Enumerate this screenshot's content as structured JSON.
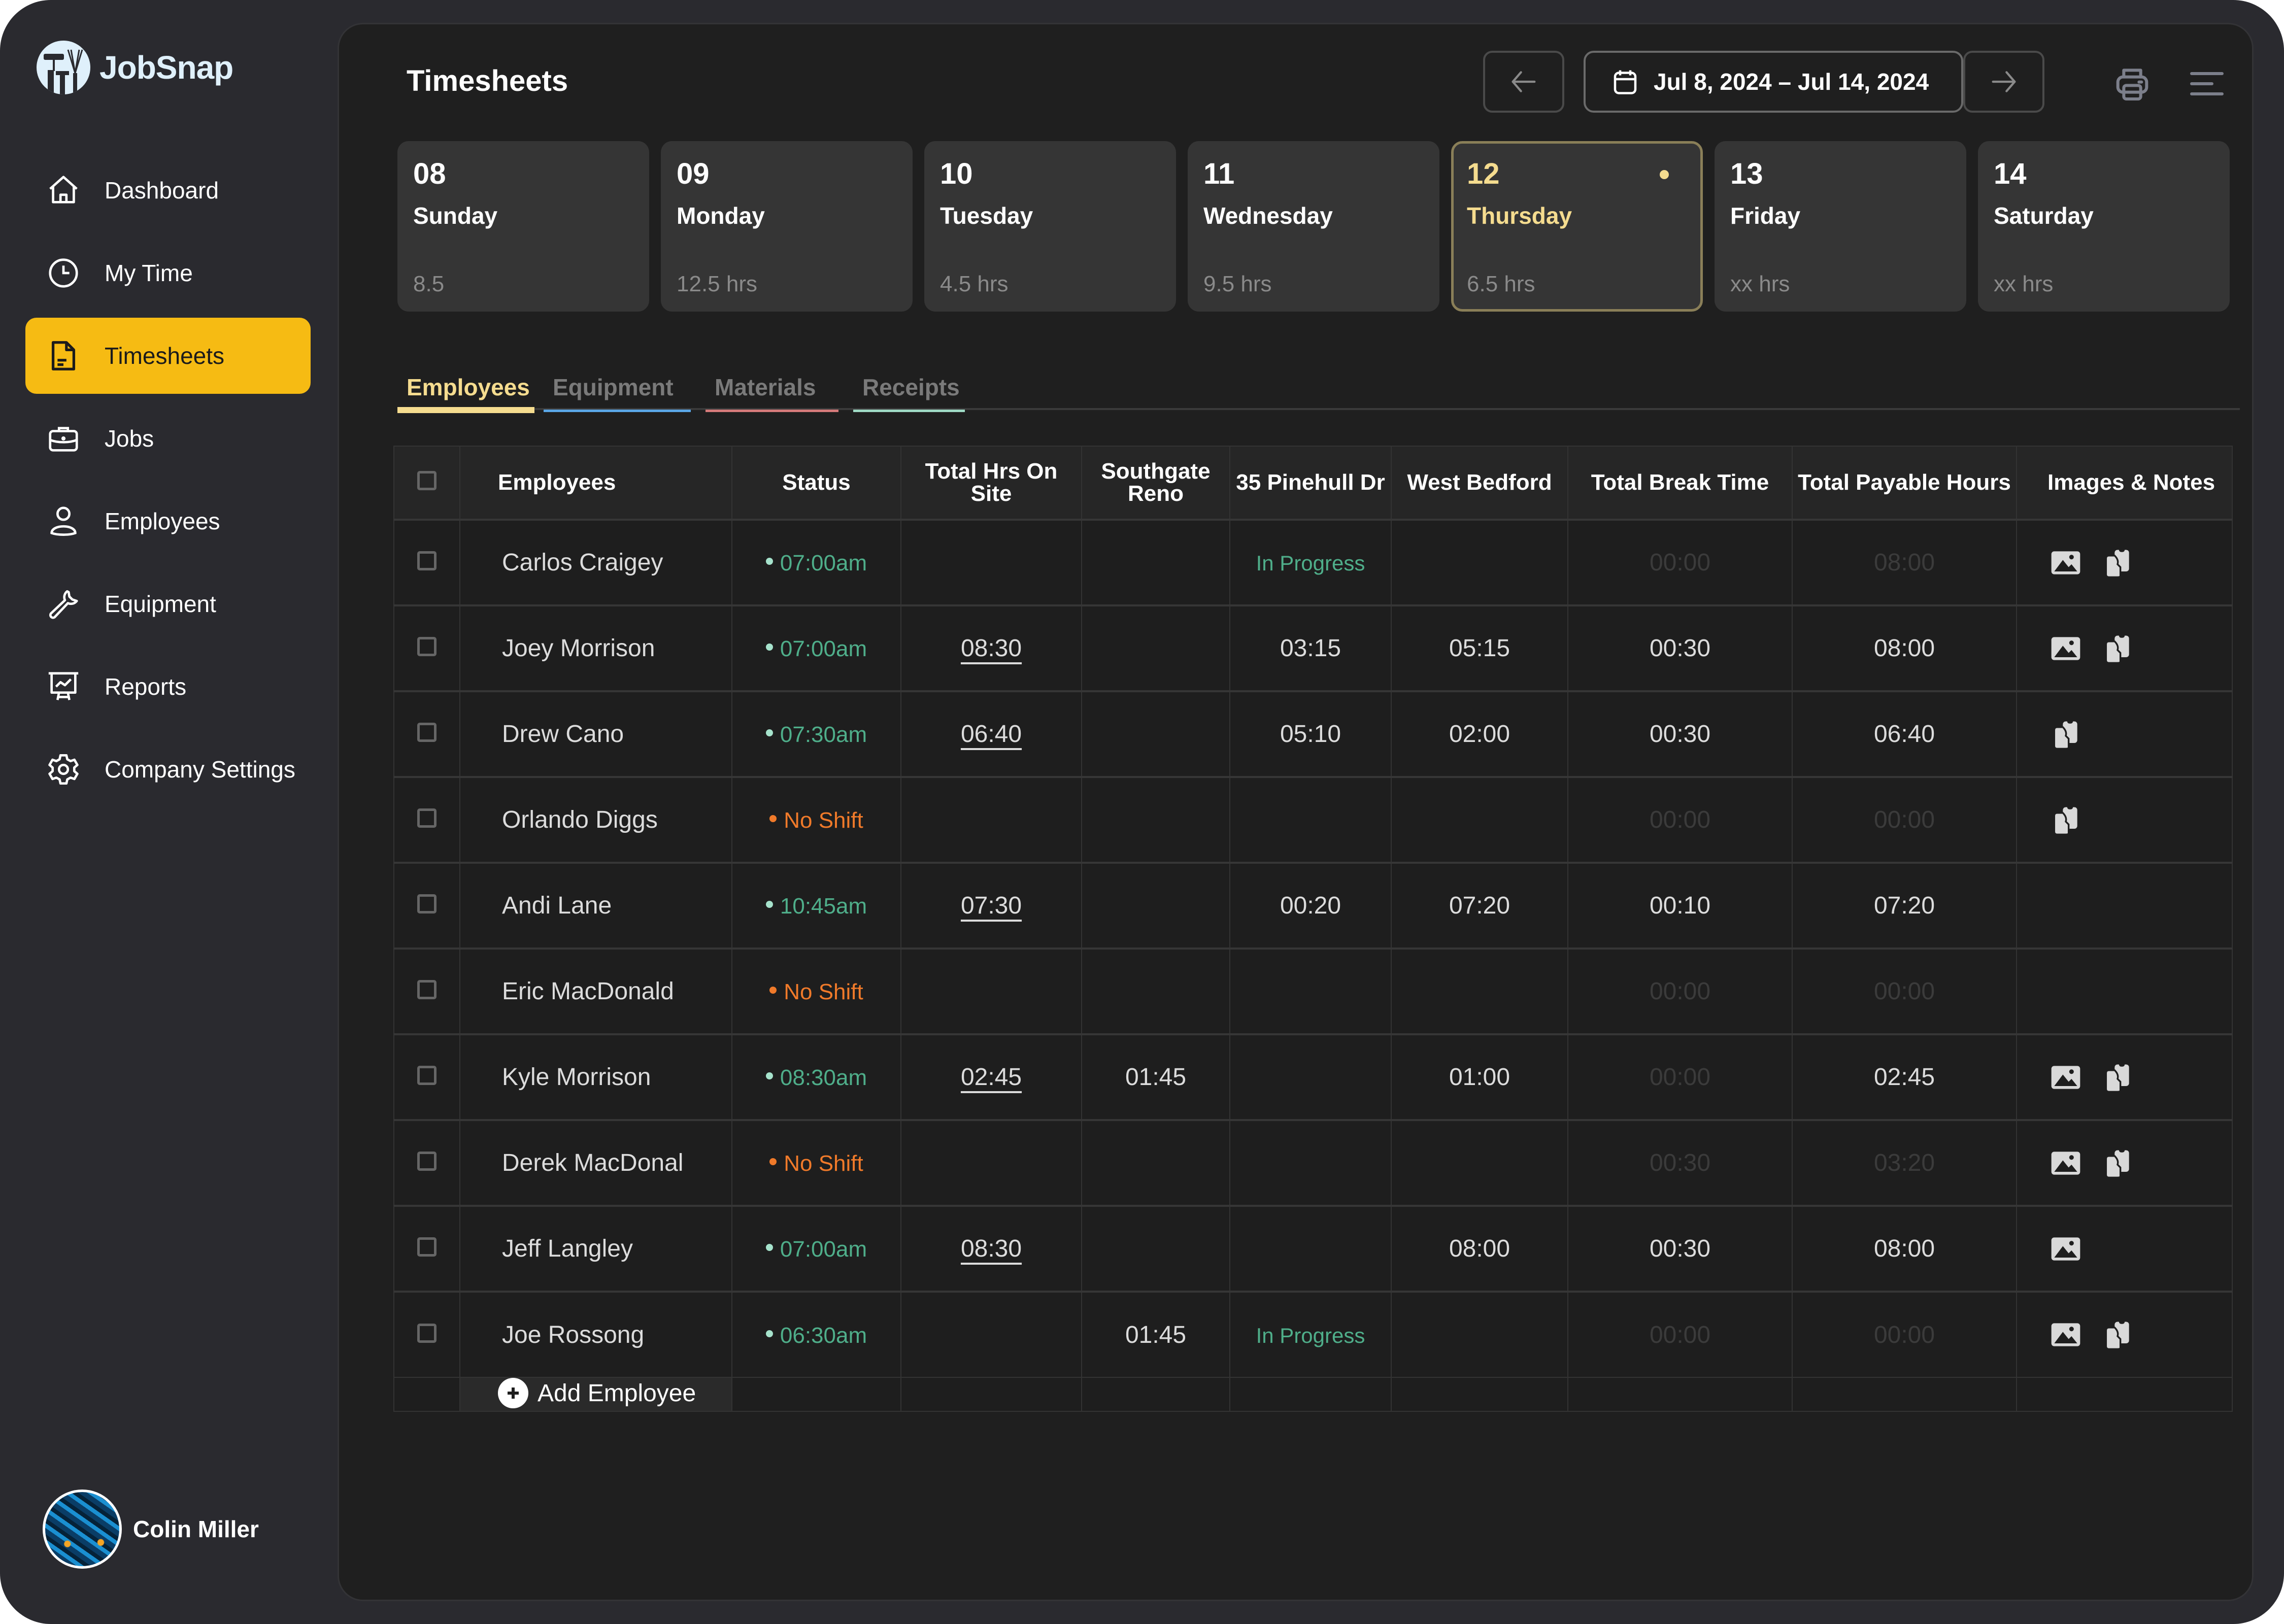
{
  "app": {
    "name": "JobSnap"
  },
  "sidebar": {
    "items": [
      {
        "label": "Dashboard",
        "icon": "home-icon",
        "active": false
      },
      {
        "label": "My Time",
        "icon": "clock-icon",
        "active": false
      },
      {
        "label": "Timesheets",
        "icon": "document-icon",
        "active": true
      },
      {
        "label": "Jobs",
        "icon": "briefcase-icon",
        "active": false
      },
      {
        "label": "Employees",
        "icon": "user-icon",
        "active": false
      },
      {
        "label": "Equipment",
        "icon": "wrench-icon",
        "active": false
      },
      {
        "label": "Reports",
        "icon": "presentation-chart-icon",
        "active": false
      },
      {
        "label": "Company Settings",
        "icon": "gear-icon",
        "active": false
      }
    ],
    "user": {
      "name": "Colin Miller"
    }
  },
  "header": {
    "title": "Timesheets",
    "date_range": "Jul 8, 2024 – Jul 14, 2024",
    "prev_icon": "arrow-left-icon",
    "next_icon": "arrow-right-icon",
    "print_icon": "printer-icon",
    "menu_icon": "menu-icon"
  },
  "days": [
    {
      "num": "08",
      "name": "Sunday",
      "hours": "8.5",
      "active": false
    },
    {
      "num": "09",
      "name": "Monday",
      "hours": "12.5 hrs",
      "active": false
    },
    {
      "num": "10",
      "name": "Tuesday",
      "hours": "4.5 hrs",
      "active": false
    },
    {
      "num": "11",
      "name": "Wednesday",
      "hours": "9.5 hrs",
      "active": false
    },
    {
      "num": "12",
      "name": "Thursday",
      "hours": "6.5 hrs",
      "active": true
    },
    {
      "num": "13",
      "name": "Friday",
      "hours": "xx hrs",
      "active": false
    },
    {
      "num": "14",
      "name": "Saturday",
      "hours": "xx hrs",
      "active": false
    }
  ],
  "tabs": [
    {
      "label": "Employees",
      "color": "#f5dc8f",
      "active": true
    },
    {
      "label": "Equipment",
      "color": "#5aa6e6",
      "active": false
    },
    {
      "label": "Materials",
      "color": "#d57a7a",
      "active": false
    },
    {
      "label": "Receipts",
      "color": "#9ed9c4",
      "active": false
    }
  ],
  "table": {
    "columns": [
      "Employees",
      "Status",
      "Total Hrs On Site",
      "Southgate Reno",
      "35 Pinehull Dr",
      "West Bedford",
      "Total Break Time",
      "Total Payable Hours",
      "Images & Notes"
    ],
    "rows": [
      {
        "name": "Carlos Craigey",
        "status": "07:00am",
        "status_type": "on",
        "total_on_site": "",
        "southgate": "",
        "pinehull": "In Progress",
        "west_bedford": "",
        "break": "00:00",
        "break_dim": true,
        "payable": "08:00",
        "payable_dim": true,
        "images": true,
        "notes": true
      },
      {
        "name": "Joey Morrison",
        "status": "07:00am",
        "status_type": "on",
        "total_on_site": "08:30",
        "southgate": "",
        "pinehull": "03:15",
        "west_bedford": "05:15",
        "break": "00:30",
        "break_dim": false,
        "payable": "08:00",
        "payable_dim": false,
        "images": true,
        "notes": true
      },
      {
        "name": "Drew Cano",
        "status": "07:30am",
        "status_type": "on",
        "total_on_site": "06:40",
        "southgate": "",
        "pinehull": "05:10",
        "west_bedford": "02:00",
        "break": "00:30",
        "break_dim": false,
        "payable": "06:40",
        "payable_dim": false,
        "images": false,
        "notes": true
      },
      {
        "name": "Orlando Diggs",
        "status": "No Shift",
        "status_type": "off",
        "total_on_site": "",
        "southgate": "",
        "pinehull": "",
        "west_bedford": "",
        "break": "00:00",
        "break_dim": true,
        "payable": "00:00",
        "payable_dim": true,
        "images": false,
        "notes": true
      },
      {
        "name": "Andi Lane",
        "status": "10:45am",
        "status_type": "on",
        "total_on_site": "07:30",
        "southgate": "",
        "pinehull": "00:20",
        "west_bedford": "07:20",
        "break": "00:10",
        "break_dim": false,
        "payable": "07:20",
        "payable_dim": false,
        "images": false,
        "notes": false
      },
      {
        "name": "Eric MacDonald",
        "status": "No Shift",
        "status_type": "off",
        "total_on_site": "",
        "southgate": "",
        "pinehull": "",
        "west_bedford": "",
        "break": "00:00",
        "break_dim": true,
        "payable": "00:00",
        "payable_dim": true,
        "images": false,
        "notes": false
      },
      {
        "name": "Kyle Morrison",
        "status": "08:30am",
        "status_type": "on",
        "total_on_site": "02:45",
        "southgate": "01:45",
        "pinehull": "",
        "west_bedford": "01:00",
        "break": "00:00",
        "break_dim": true,
        "payable": "02:45",
        "payable_dim": false,
        "images": true,
        "notes": true
      },
      {
        "name": "Derek MacDonal",
        "status": "No Shift",
        "status_type": "off",
        "total_on_site": "",
        "southgate": "",
        "pinehull": "",
        "west_bedford": "",
        "break": "00:30",
        "break_dim": true,
        "payable": "03:20",
        "payable_dim": true,
        "images": true,
        "notes": true
      },
      {
        "name": "Jeff Langley",
        "status": "07:00am",
        "status_type": "on",
        "total_on_site": "08:30",
        "southgate": "",
        "pinehull": "",
        "west_bedford": "08:00",
        "break": "00:30",
        "break_dim": false,
        "payable": "08:00",
        "payable_dim": false,
        "images": true,
        "notes": false
      },
      {
        "name": "Joe Rossong",
        "status": "06:30am",
        "status_type": "on",
        "total_on_site": "",
        "southgate": "01:45",
        "pinehull": "In Progress",
        "west_bedford": "",
        "break": "00:00",
        "break_dim": true,
        "payable": "00:00",
        "payable_dim": true,
        "images": true,
        "notes": true
      }
    ],
    "add_label": "Add Employee"
  },
  "colors": {
    "accent": "#f6bb13",
    "active_day": "#f5dc8f",
    "status_on": "#4fae8a",
    "status_off": "#f07a2a"
  }
}
